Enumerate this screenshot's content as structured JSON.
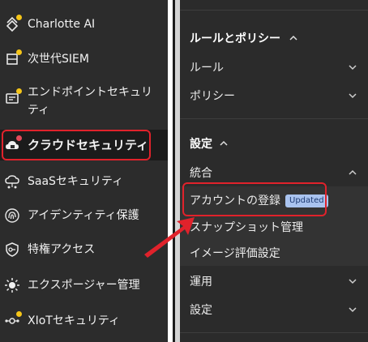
{
  "sidebar": {
    "items": [
      {
        "label": "Charlotte AI",
        "icon": "charlotte-ai-icon"
      },
      {
        "label": "次世代SIEM",
        "icon": "siem-icon"
      },
      {
        "label_line1": "エンドポイントセキュリ",
        "label_line2": "ティ",
        "icon": "endpoint-icon"
      },
      {
        "label": "クラウドセキュリティ",
        "icon": "cloud-lock-icon",
        "active": true
      },
      {
        "label": "SaaSセキュリティ",
        "icon": "saas-cloud-icon"
      },
      {
        "label": "アイデンティティ保護",
        "icon": "fingerprint-icon"
      },
      {
        "label": "特権アクセス",
        "icon": "shield-key-icon"
      },
      {
        "label": "エクスポージャー管理",
        "icon": "sun-icon"
      },
      {
        "label": "XIoTセキュリティ",
        "icon": "iot-nodes-icon"
      }
    ]
  },
  "panel": {
    "rules_section": "ルールとポリシー",
    "rules": "ルール",
    "policies": "ポリシー",
    "settings_section": "設定",
    "integration": "統合",
    "account_registration": "アカウントの登録",
    "updated_badge": "Updated",
    "snapshot_management": "スナップショット管理",
    "image_evaluation_settings": "イメージ評価設定",
    "operations": "運用",
    "settings": "設定"
  },
  "colors": {
    "highlight": "#e0222b",
    "badge_bg": "#a9c3ef",
    "notification_dot": "#f5c518"
  }
}
